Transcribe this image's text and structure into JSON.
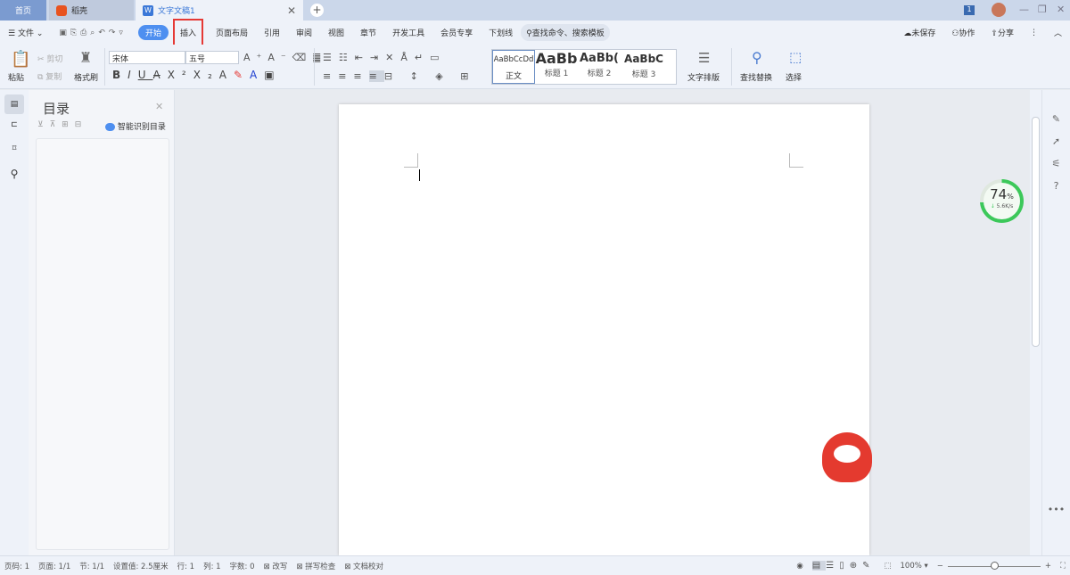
{
  "tabs": [
    {
      "label": "首页"
    },
    {
      "label": "稻壳"
    },
    {
      "label": "文字文稿1"
    }
  ],
  "window": {
    "badge": "1"
  },
  "menu": {
    "file": "文件",
    "items": [
      "开始",
      "插入",
      "页面布局",
      "引用",
      "审阅",
      "视图",
      "章节",
      "开发工具",
      "会员专享",
      "下划线"
    ],
    "search": "查找命令、搜索模板",
    "unsaved": "未保存",
    "collab": "协作",
    "share": "分享"
  },
  "ribbon": {
    "paste": "粘贴",
    "cut": "剪切",
    "copy": "复制",
    "format_painter": "格式刷",
    "font": "宋体",
    "size": "五号",
    "styles": [
      {
        "preview": "AaBbCcDd",
        "label": "正文"
      },
      {
        "preview": "AaBb",
        "label": "标题 1"
      },
      {
        "preview": "AaBb(",
        "label": "标题 2"
      },
      {
        "preview": "AaBbC",
        "label": "标题 3"
      }
    ],
    "text_layout": "文字排版",
    "find_replace": "查找替换",
    "select": "选择"
  },
  "toc": {
    "title": "目录",
    "smart": "智能识别目录"
  },
  "speed": {
    "percent": "74",
    "unit": "%",
    "rate": "5.6K/s"
  },
  "status": {
    "page_num": "页码: 1",
    "pages": "页面: 1/1",
    "section": "节: 1/1",
    "setting": "设置值: 2.5厘米",
    "row": "行: 1",
    "col": "列: 1",
    "words": "字数: 0",
    "revise": "改写",
    "spell": "拼写检查",
    "proof": "文档校对",
    "zoom": "100%",
    "zoom_level": 0.5
  },
  "colors": {
    "accent": "#4e8ff0",
    "highlight_box": "#e53935"
  }
}
